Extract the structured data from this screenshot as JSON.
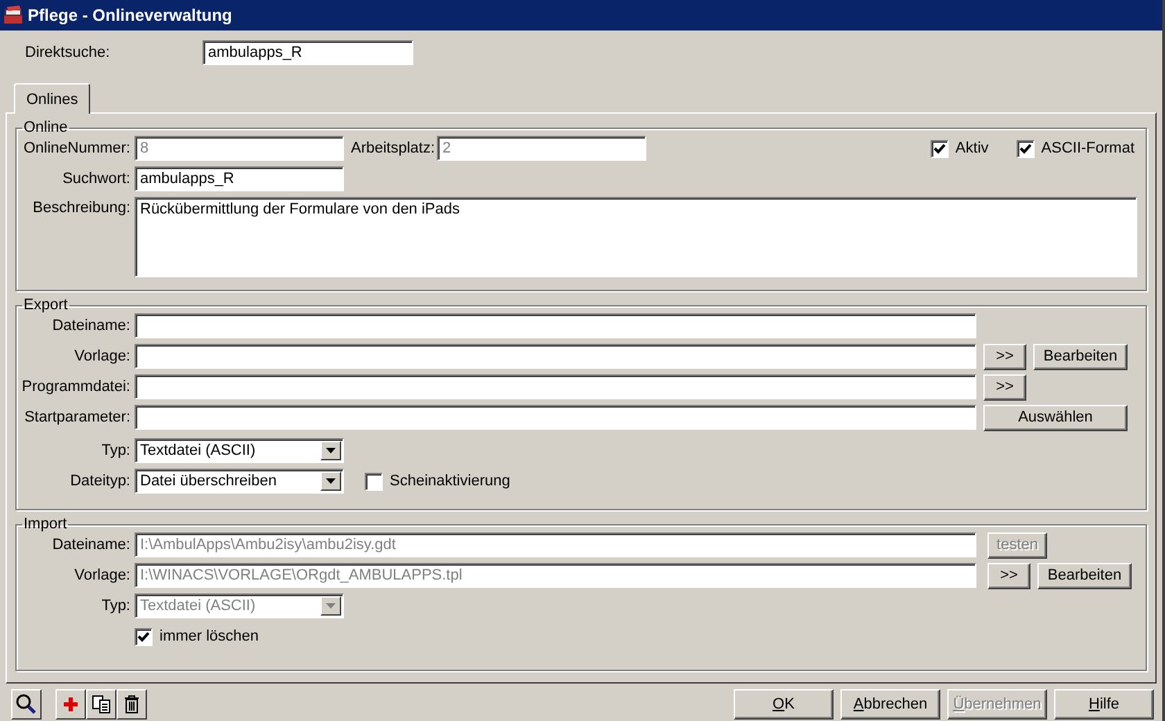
{
  "window": {
    "title": "Pflege - Onlineverwaltung"
  },
  "direct_search": {
    "label": "Direktsuche:",
    "value": "ambulapps_R"
  },
  "tabs": [
    {
      "label": "Onlines",
      "selected": true
    }
  ],
  "online": {
    "title": "Online",
    "online_number": {
      "label": "OnlineNummer:",
      "value": "8",
      "disabled": true
    },
    "workstation": {
      "label": "Arbeitsplatz:",
      "value": "2",
      "disabled": true
    },
    "checkboxes": [
      {
        "label": "Aktiv",
        "checked": true
      },
      {
        "label": "ASCII-Format",
        "checked": true
      }
    ],
    "keyword": {
      "label": "Suchwort:",
      "value": "ambulapps_R",
      "disabled": false
    },
    "description": {
      "label": "Beschreibung:",
      "value": "Rückübermittlung der Formulare von den iPads"
    }
  },
  "export": {
    "title": "Export",
    "rows": [
      {
        "label": "Dateiname:",
        "buttons": []
      },
      {
        "label": "Vorlage:",
        "buttons": [
          {
            "label": ">>",
            "kind": "small",
            "disabled": false
          },
          {
            "label": "Bearbeiten",
            "kind": "normal",
            "disabled": false
          }
        ]
      },
      {
        "label": "Programmdatei:",
        "buttons": [
          {
            "label": ">>",
            "kind": "small",
            "disabled": false
          }
        ]
      },
      {
        "label": "Startparameter:",
        "buttons": [
          {
            "label": "Auswählen",
            "kind": "wide",
            "disabled": false
          }
        ]
      }
    ],
    "type": {
      "label": "Typ:",
      "value": "Textdatei (ASCII)",
      "disabled": false
    },
    "file_type": {
      "label": "Dateityp:",
      "value": "Datei überschreiben",
      "disabled": false
    },
    "fake_activation": {
      "label": "Scheinaktivierung",
      "checked": false
    }
  },
  "import": {
    "title": "Import",
    "rows": [
      {
        "label": "Dateiname:",
        "value": "I:\\AmbulApps\\Ambu2isy\\ambu2isy.gdt",
        "disabled": true,
        "buttons": [
          {
            "label": "testen",
            "kind": "normal",
            "disabled": true
          }
        ]
      },
      {
        "label": "Vorlage:",
        "value": "I:\\WINACS\\VORLAGE\\ORgdt_AMBULAPPS.tpl",
        "disabled": true,
        "buttons": [
          {
            "label": ">>",
            "kind": "small",
            "disabled": false
          },
          {
            "label": "Bearbeiten",
            "kind": "normal",
            "disabled": false
          }
        ]
      }
    ],
    "type": {
      "label": "Typ:",
      "value": "Textdatei (ASCII)",
      "disabled": true
    },
    "always_delete": {
      "label": "immer löschen",
      "checked": true
    }
  },
  "toolbar": [
    {
      "kind": "search"
    },
    {
      "kind": "add"
    },
    {
      "kind": "copy"
    },
    {
      "kind": "delete"
    }
  ],
  "buttons": [
    {
      "accel": "O",
      "rest": "K",
      "disabled": false
    },
    {
      "accel": "A",
      "rest": "bbrechen",
      "disabled": false
    },
    {
      "accel": "Ü",
      "rest": "bernehmen",
      "disabled": true
    },
    {
      "accel": "H",
      "rest": "ilfe",
      "disabled": false
    }
  ]
}
